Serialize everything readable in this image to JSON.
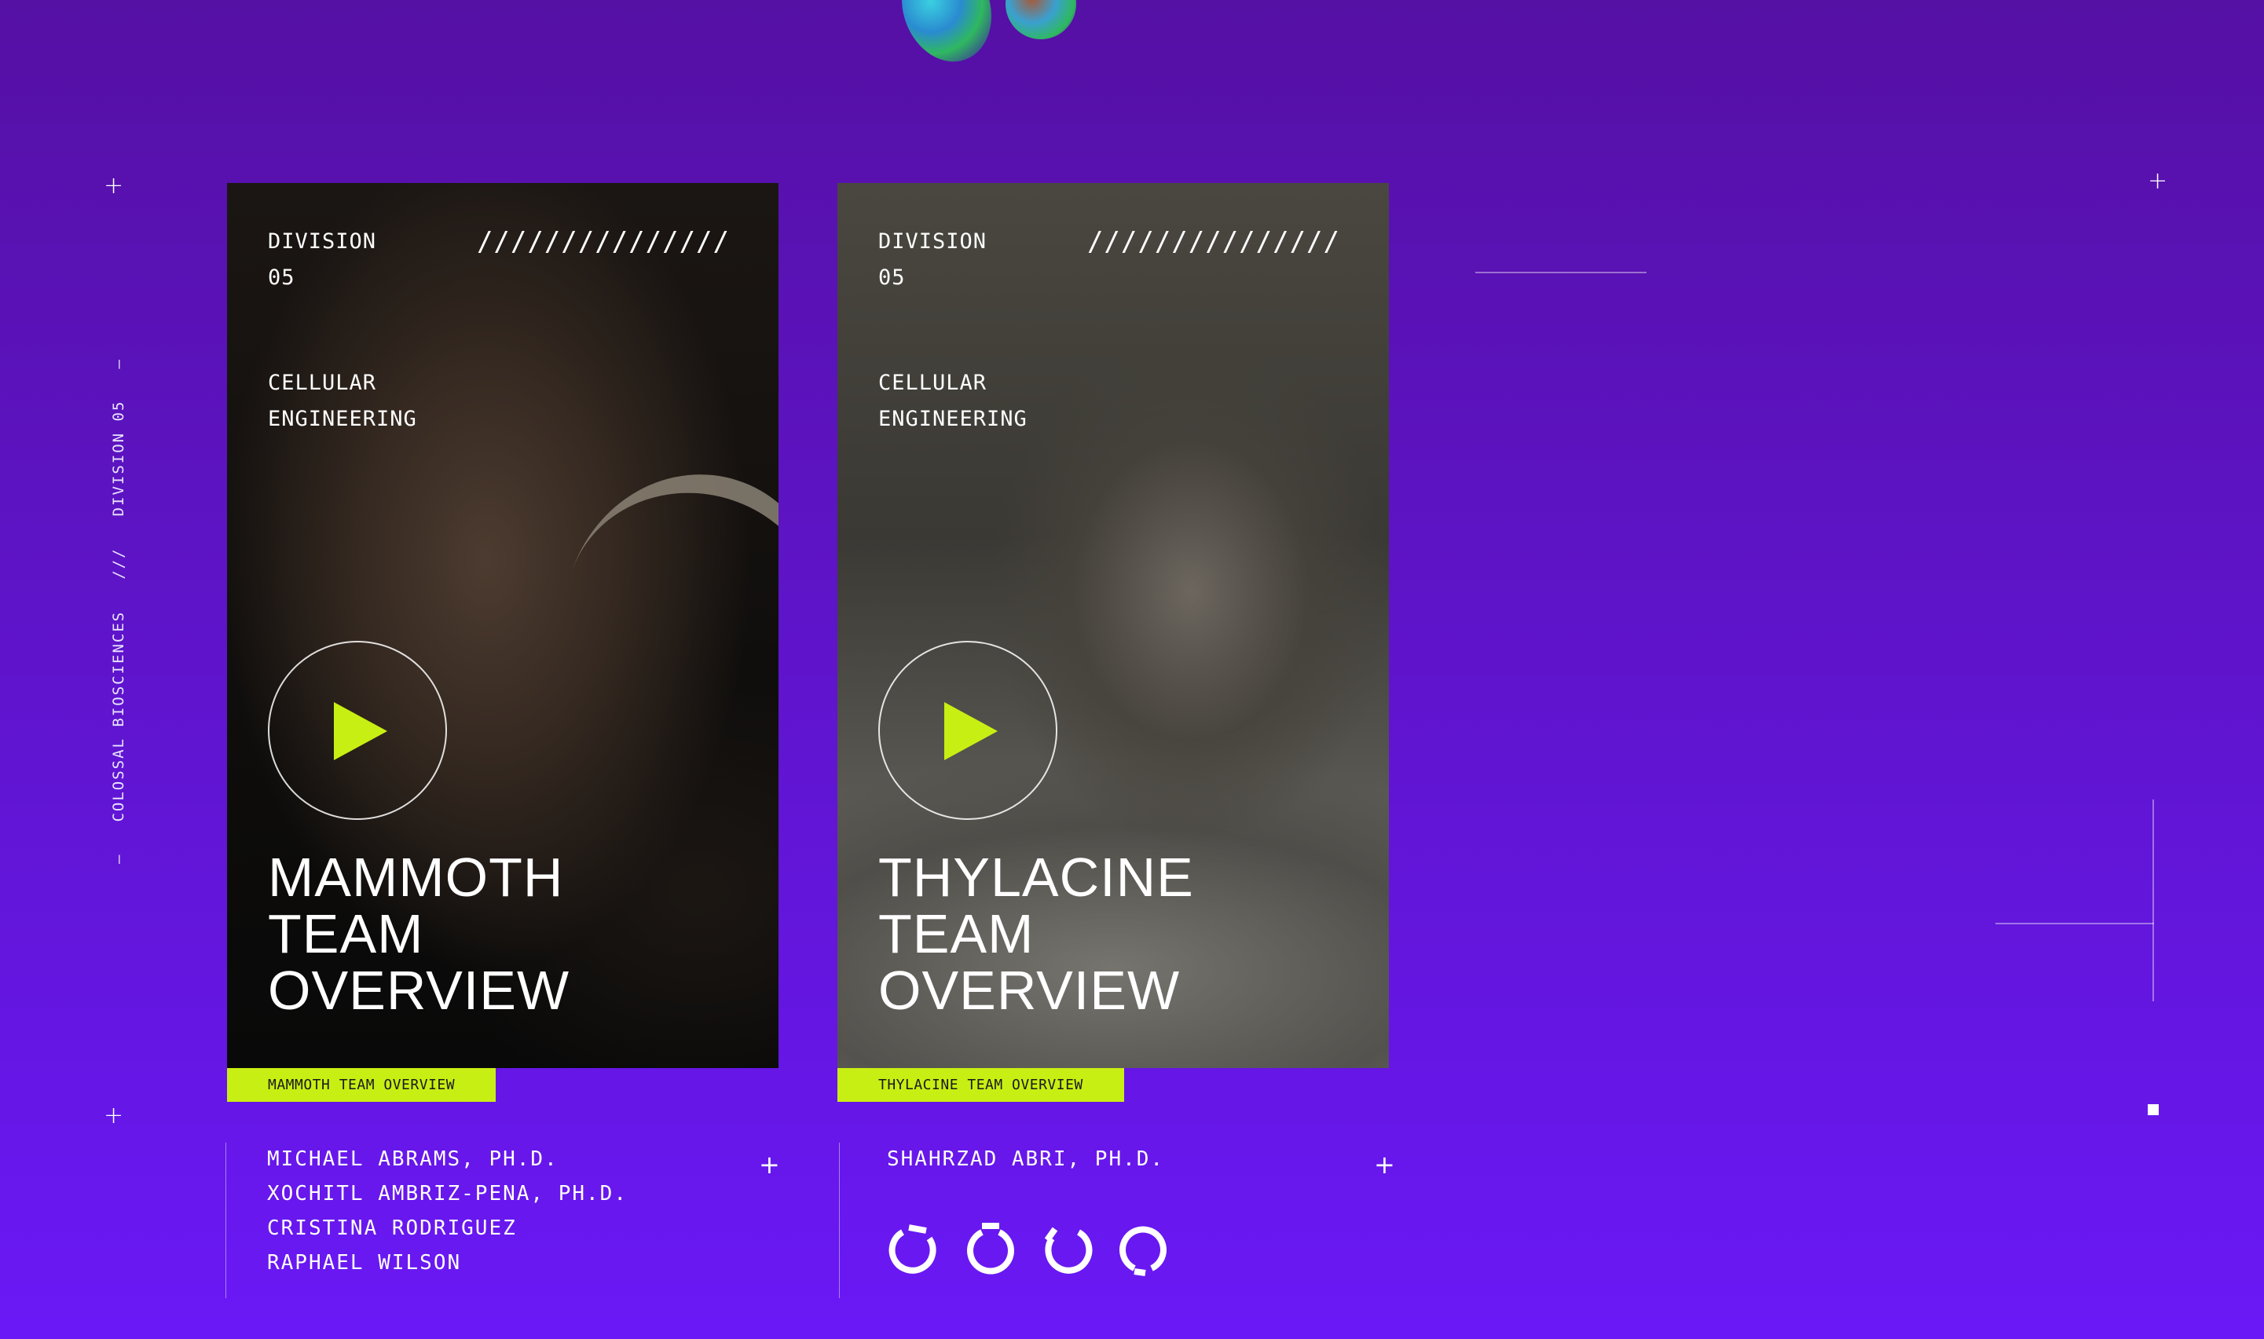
{
  "sidebar": {
    "brand": "COLOSSAL BIOSCIENCES",
    "separator": "///",
    "division": "DIVISION 05",
    "tick": "—"
  },
  "cards": [
    {
      "division_label": "DIVISION",
      "division_number": "05",
      "slashes": "///////////////",
      "category_line1": "CELLULAR",
      "category_line2": "ENGINEERING",
      "title": "MAMMOTH\nTEAM\nOVERVIEW",
      "tag": "MAMMOTH TEAM OVERVIEW",
      "members": [
        "MICHAEL ABRAMS, PH.D.",
        "XOCHITL AMBRIZ-PENA, PH.D.",
        "CRISTINA RODRIGUEZ",
        "RAPHAEL WILSON"
      ]
    },
    {
      "division_label": "DIVISION",
      "division_number": "05",
      "slashes": "///////////////",
      "category_line1": "CELLULAR",
      "category_line2": "ENGINEERING",
      "title": "THYLACINE\nTEAM\nOVERVIEW",
      "tag": "THYLACINE TEAM OVERVIEW",
      "members": [
        "SHAHRZAD ABRI, PH.D."
      ]
    }
  ],
  "plus_symbol": "+",
  "colors": {
    "accent": "#c8ef13",
    "background_top": "#5510a4",
    "background_bottom": "#6a18f6"
  },
  "icons": [
    "play-icon",
    "loader-icon"
  ]
}
